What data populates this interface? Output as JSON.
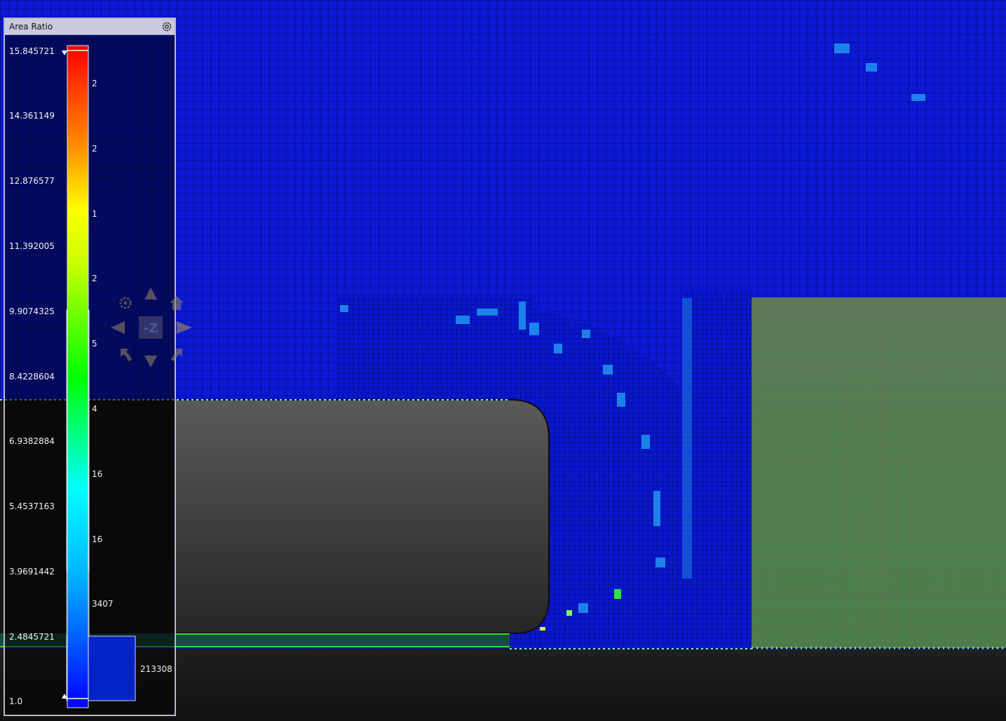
{
  "legend": {
    "title": "Area Ratio",
    "settings_icon": "gear-icon",
    "ticks": [
      "15.845721",
      "14.361149",
      "12.876577",
      "11.392005",
      "9.9074325",
      "8.4228604",
      "6.9382884",
      "5.4537163",
      "3.9691442",
      "2.4845721",
      "1.0"
    ],
    "counts": [
      "2",
      "2",
      "1",
      "2",
      "5",
      "4",
      "16",
      "16",
      "3407",
      "213308"
    ]
  },
  "colors": {
    "mesh_blue": "#0a17d6",
    "mesh_line": "#000a40",
    "grid_green": "#2a9a2a",
    "boundary_cyan": "#6ff1ff",
    "body_gray": "#4f4f4f",
    "histogram_fill": "#0524c8"
  },
  "orientation": {
    "label": "-Z",
    "icons": [
      "gear-icon",
      "up-arrow-icon",
      "home-icon",
      "left-arrow-icon",
      "right-arrow-icon",
      "rotate-ccw-icon",
      "down-arrow-icon",
      "rotate-cw-icon"
    ]
  }
}
